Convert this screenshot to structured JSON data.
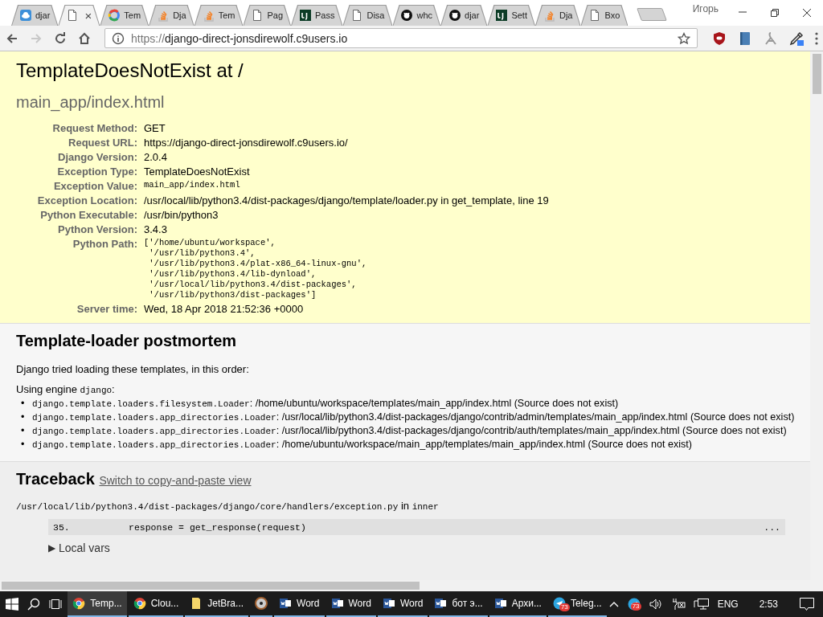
{
  "browser": {
    "tabs": [
      {
        "kind": "cloud",
        "label": "djar",
        "selected": false
      },
      {
        "kind": "page",
        "close": "×",
        "selected": true
      },
      {
        "kind": "ring",
        "label": "Tem",
        "selected": false
      },
      {
        "kind": "stack",
        "label": "Dja",
        "selected": false
      },
      {
        "kind": "stack",
        "label": "Tem",
        "selected": false
      },
      {
        "kind": "page",
        "label": "Pag",
        "selected": false
      },
      {
        "kind": "square",
        "label": "Pass",
        "selected": false
      },
      {
        "kind": "page",
        "label": "Disa",
        "selected": false
      },
      {
        "kind": "octocat",
        "label": "whc",
        "selected": false
      },
      {
        "kind": "octocat",
        "label": "djar",
        "selected": false
      },
      {
        "kind": "square",
        "label": "Sett",
        "selected": false
      },
      {
        "kind": "stack",
        "label": "Dja",
        "selected": false
      },
      {
        "kind": "page",
        "label": "Bxo",
        "selected": false
      }
    ],
    "profile": "Игорь",
    "nav": [
      {
        "kind": "back",
        "disabled": false
      },
      {
        "kind": "forward",
        "disabled": true
      },
      {
        "kind": "reload",
        "disabled": false
      },
      {
        "kind": "home",
        "disabled": false
      }
    ],
    "url": {
      "scheme": "https://",
      "host": "django-direct-jonsdirewolf.c9users.io"
    }
  },
  "page": {
    "title": "TemplateDoesNotExist at /",
    "subtitle": "main_app/index.html",
    "meta": [
      {
        "label": "Request Method:",
        "value": "GET",
        "kind": "text"
      },
      {
        "label": "Request URL:",
        "value": "https://django-direct-jonsdirewolf.c9users.io/",
        "kind": "text"
      },
      {
        "label": "Django Version:",
        "value": "2.0.4",
        "kind": "text"
      },
      {
        "label": "Exception Type:",
        "value": "TemplateDoesNotExist",
        "kind": "text"
      },
      {
        "label": "Exception Value:",
        "value": "main_app/index.html",
        "kind": "code"
      },
      {
        "label": "Exception Location:",
        "value": "/usr/local/lib/python3.4/dist-packages/django/template/loader.py in get_template, line 19",
        "kind": "text"
      },
      {
        "label": "Python Executable:",
        "value": "/usr/bin/python3",
        "kind": "text"
      },
      {
        "label": "Python Version:",
        "value": "3.4.3",
        "kind": "text"
      },
      {
        "label": "Python Path:",
        "value": "['/home/ubuntu/workspace',\n '/usr/lib/python3.4',\n '/usr/lib/python3.4/plat-x86_64-linux-gnu',\n '/usr/lib/python3.4/lib-dynload',\n '/usr/local/lib/python3.4/dist-packages',\n '/usr/lib/python3/dist-packages']",
        "kind": "code"
      },
      {
        "label": "Server time:",
        "value": "Wed, 18 Apr 2018 21:52:36 +0000",
        "kind": "text"
      }
    ],
    "postmortem": {
      "heading": "Template-loader postmortem",
      "intro": "Django tried loading these templates, in this order:",
      "engine_prefix": "Using engine",
      "engine": "django",
      "engine_suffix": ":",
      "loaders": [
        {
          "marker": "•",
          "loader": "django.template.loaders.filesystem.Loader",
          "detail": ": /home/ubuntu/workspace/templates/main_app/index.html (Source does not exist)"
        },
        {
          "marker": "•",
          "loader": "django.template.loaders.app_directories.Loader",
          "detail": ": /usr/local/lib/python3.4/dist-packages/django/contrib/admin/templates/main_app/index.html (Source does not exist)"
        },
        {
          "marker": "•",
          "loader": "django.template.loaders.app_directories.Loader",
          "detail": ": /usr/local/lib/python3.4/dist-packages/django/contrib/auth/templates/main_app/index.html (Source does not exist)"
        },
        {
          "marker": "•",
          "loader": "django.template.loaders.app_directories.Loader",
          "detail": ": /home/ubuntu/workspace/main_app/templates/main_app/index.html (Source does not exist)"
        }
      ]
    },
    "traceback": {
      "heading": "Traceback",
      "link": "Switch to copy-and-paste view",
      "file": "/usr/local/lib/python3.4/dist-packages/django/core/handlers/exception.py",
      "in": "in",
      "function": "inner",
      "line_number": "35.",
      "code": "response = get_response(request)",
      "more": "...",
      "toggle": "▶",
      "vars_label": "Local vars",
      "expanded": false
    }
  },
  "taskbar": {
    "items": [
      {
        "kind": "chrome",
        "label": "Temp...",
        "selected": true
      },
      {
        "kind": "chrome",
        "label": "Clou...",
        "selected": false
      },
      {
        "kind": "folder",
        "label": "JetBra...",
        "selected": false
      },
      {
        "kind": "disc",
        "selected": false
      },
      {
        "kind": "word",
        "label": "Word",
        "selected": false
      },
      {
        "kind": "word",
        "label": "Word",
        "selected": false
      },
      {
        "kind": "word",
        "label": "Word",
        "selected": false
      },
      {
        "kind": "word",
        "label": "бот э...",
        "selected": false
      },
      {
        "kind": "word",
        "label": "Архи...",
        "selected": false
      },
      {
        "kind": "telegram",
        "label": "Teleg...",
        "badge": "73",
        "selected": false
      }
    ],
    "tray_badge": "73",
    "language": "ENG",
    "time": "2:53"
  }
}
